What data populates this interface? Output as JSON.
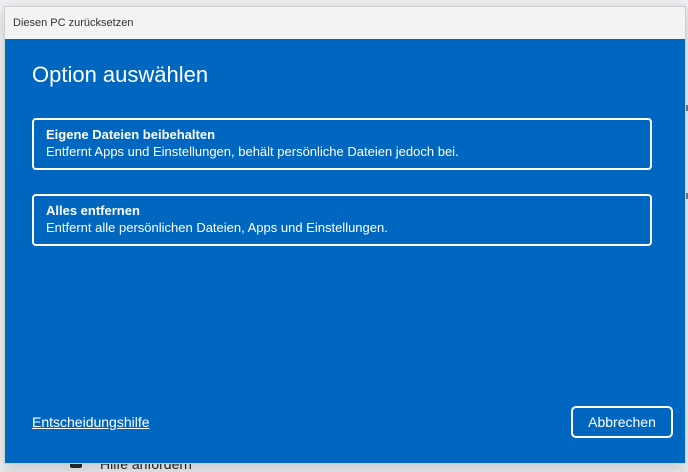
{
  "window": {
    "title": "Diesen PC zurücksetzen"
  },
  "dialog": {
    "heading": "Option auswählen",
    "options": [
      {
        "title": "Eigene Dateien beibehalten",
        "description": "Entfernt Apps und Einstellungen, behält persönliche Dateien jedoch bei."
      },
      {
        "title": "Alles entfernen",
        "description": "Entfernt alle persönlichen Dateien, Apps und Einstellungen."
      }
    ],
    "help_link": "Entscheidungshilfe",
    "cancel_label": "Abbrechen"
  },
  "background": {
    "partial_item_label": "Hilfe anfordern"
  },
  "colors": {
    "accent": "#0067c0",
    "text_on_accent": "#ffffff",
    "titlebar": "#f3f3f3"
  }
}
